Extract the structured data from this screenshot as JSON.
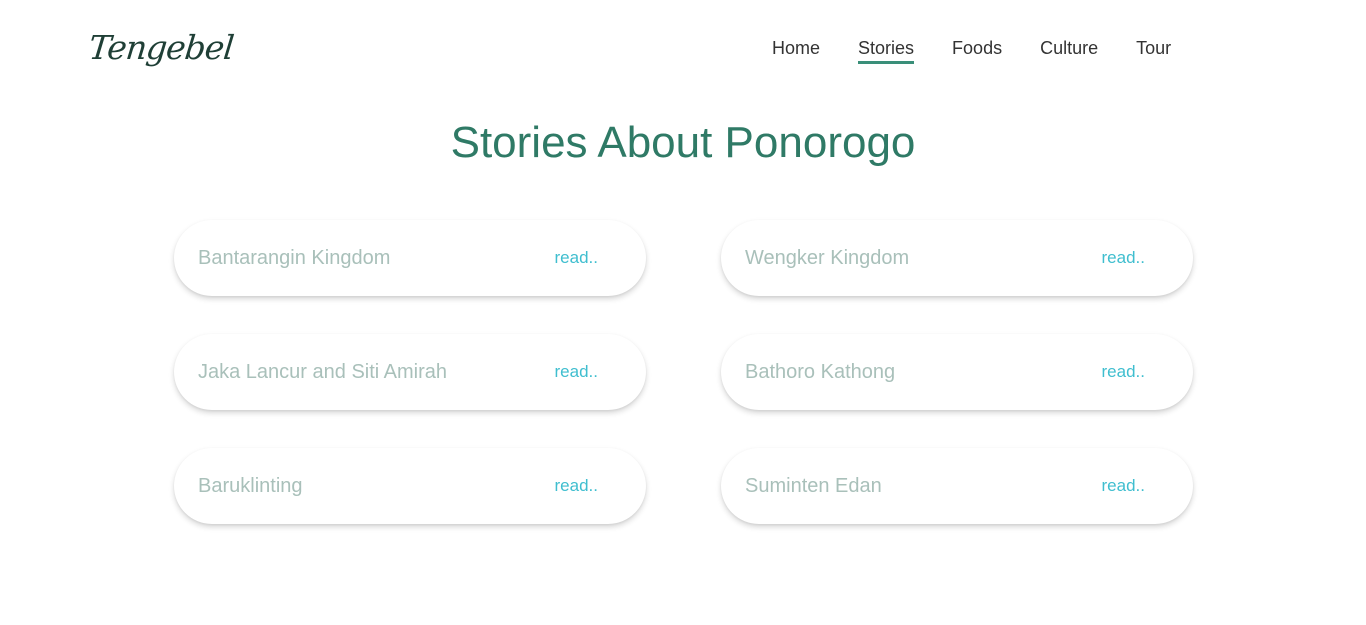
{
  "brand": {
    "logo_text": "Tengebel"
  },
  "nav": {
    "items": [
      {
        "label": "Home"
      },
      {
        "label": "Stories"
      },
      {
        "label": "Foods"
      },
      {
        "label": "Culture"
      },
      {
        "label": "Tour"
      }
    ],
    "active": "Stories"
  },
  "main": {
    "title": "Stories About Ponorogo",
    "stories": [
      {
        "title": "Bantarangin Kingdom",
        "link": "read.."
      },
      {
        "title": "Wengker Kingdom",
        "link": "read.."
      },
      {
        "title": "Jaka Lancur and Siti Amirah",
        "link": "read.."
      },
      {
        "title": "Bathoro Kathong",
        "link": "read.."
      },
      {
        "title": "Baruklinting",
        "link": "read.."
      },
      {
        "title": "Suminten Edan",
        "link": "read.."
      }
    ]
  },
  "colors": {
    "accent": "#2f7a66",
    "nav_underline": "#3a8f79",
    "card_title": "#a9c0ba",
    "link": "#3fbecf"
  }
}
